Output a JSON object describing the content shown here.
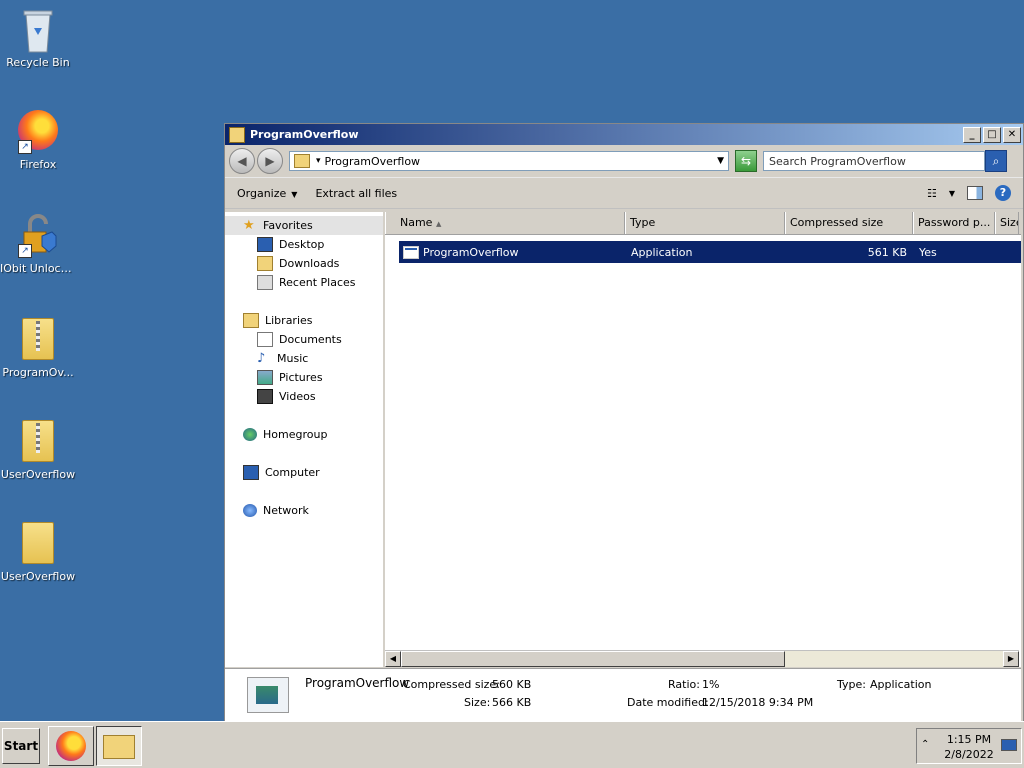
{
  "desktop": {
    "icons": [
      {
        "label": "Recycle Bin",
        "icon": "recycle-bin-icon"
      },
      {
        "label": "Firefox",
        "icon": "firefox-icon"
      },
      {
        "label": "IObit Unlocker",
        "icon": "unlocker-icon"
      },
      {
        "label": "ProgramOv...",
        "icon": "zip-folder-icon"
      },
      {
        "label": "UserOverflow",
        "icon": "zip-folder-icon"
      },
      {
        "label": "UserOverflow",
        "icon": "folder-icon"
      }
    ]
  },
  "window": {
    "title": "ProgramOverflow",
    "address": "ProgramOverflow",
    "search_placeholder": "Search ProgramOverflow",
    "toolbar": {
      "organize": "Organize",
      "extract": "Extract all files"
    },
    "nav": {
      "favorites": "Favorites",
      "desktop": "Desktop",
      "downloads": "Downloads",
      "recent": "Recent Places",
      "libraries": "Libraries",
      "documents": "Documents",
      "music": "Music",
      "pictures": "Pictures",
      "videos": "Videos",
      "homegroup": "Homegroup",
      "computer": "Computer",
      "network": "Network"
    },
    "columns": {
      "name": "Name",
      "type": "Type",
      "compressed": "Compressed size",
      "password": "Password p...",
      "size": "Size"
    },
    "rows": [
      {
        "name": "ProgramOverflow",
        "type": "Application",
        "compressed": "561 KB",
        "password": "Yes"
      }
    ],
    "details": {
      "name": "ProgramOverflow",
      "compressed_label": "Compressed size:",
      "compressed_value": "560 KB",
      "size_label": "Size:",
      "size_value": "566 KB",
      "ratio_label": "Ratio:",
      "ratio_value": "1%",
      "modified_label": "Date modified:",
      "modified_value": "12/15/2018 9:34 PM",
      "type_label": "Type:",
      "type_value": "Application"
    }
  },
  "taskbar": {
    "start": "Start",
    "time": "1:15 PM",
    "date": "2/8/2022"
  }
}
